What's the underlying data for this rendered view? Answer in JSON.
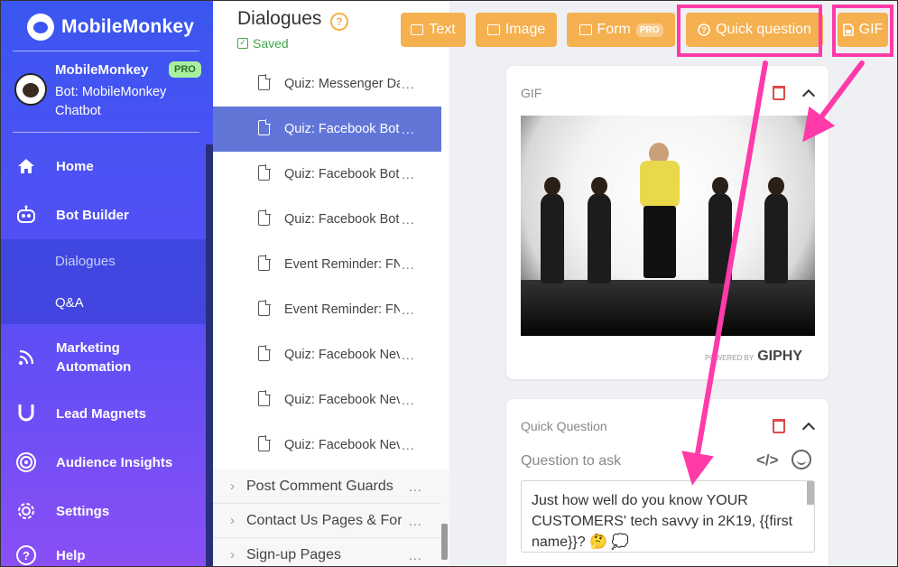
{
  "brand": {
    "name": "MobileMonkey"
  },
  "bot": {
    "org": "MobileMonkey",
    "pro_badge": "PRO",
    "bot_name": "Bot: MobileMonkey Chatbot"
  },
  "nav": {
    "home": "Home",
    "bot_builder": "Bot Builder",
    "dialogues": "Dialogues",
    "qa": "Q&A",
    "marketing_automation": "Marketing Automation",
    "lead_magnets": "Lead Magnets",
    "audience_insights": "Audience Insights",
    "settings": "Settings",
    "help": "Help"
  },
  "header": {
    "title": "Dialogues",
    "help_glyph": "?",
    "saved": "Saved"
  },
  "dialogues": [
    {
      "label": "Quiz: Messenger Da",
      "more": "...",
      "selected": false
    },
    {
      "label": "Quiz: Facebook Bot",
      "more": "...",
      "selected": true
    },
    {
      "label": "Quiz: Facebook Bot",
      "more": "...",
      "selected": false
    },
    {
      "label": "Quiz: Facebook Bot",
      "more": "...",
      "selected": false
    },
    {
      "label": "Event Reminder: FN",
      "more": "...",
      "selected": false
    },
    {
      "label": "Event Reminder: FN",
      "more": "...",
      "selected": false
    },
    {
      "label": "Quiz: Facebook Nev",
      "more": "...",
      "selected": false
    },
    {
      "label": "Quiz: Facebook Nev",
      "more": "...",
      "selected": false
    },
    {
      "label": "Quiz: Facebook Nev",
      "more": "...",
      "selected": false
    }
  ],
  "folders": [
    {
      "label": "Post Comment Guards",
      "more": "..."
    },
    {
      "label": "Contact Us Pages & Forr",
      "more": "..."
    },
    {
      "label": "Sign-up Pages",
      "more": "..."
    }
  ],
  "toolbar": {
    "text": "Text",
    "image": "Image",
    "form": "Form",
    "form_badge": "PRO",
    "quick_question": "Quick question",
    "gif": "GIF"
  },
  "gif_card": {
    "label": "GIF",
    "powered_by": "POWERED BY",
    "giphy": "GIPHY"
  },
  "quick_question_card": {
    "label": "Quick Question",
    "question_to_ask": "Question to ask",
    "code_glyph": "</>",
    "question_text": "Just how well do you know YOUR CUSTOMERS' tech savvy in 2K19, {{first name}}? 🤔 💭"
  },
  "colors": {
    "sidebar_top": "#3a56f0",
    "sidebar_bottom": "#8a4ff5",
    "toolbar_button": "#f5b04f",
    "selected_row": "#6276d8",
    "annotation": "#ff3aa9",
    "saved_green": "#41a64a",
    "trash_red": "#e04a4a"
  }
}
